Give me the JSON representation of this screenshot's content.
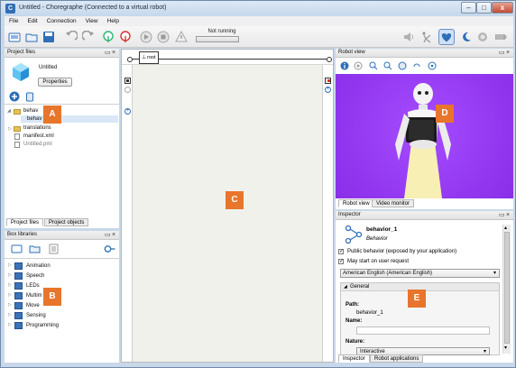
{
  "window": {
    "title": "Untitled - Choregraphe (Connected to a virtual robot)",
    "app_icon": "C",
    "minimize_glyph": "–",
    "maximize_glyph": "□",
    "close_glyph": "x"
  },
  "menu": [
    "File",
    "Edit",
    "Connection",
    "View",
    "Help"
  ],
  "toolbar": {
    "status_text": "Not running"
  },
  "project_files": {
    "title": "Project files",
    "project_name": "Untitled",
    "properties_button": "Properties",
    "tree": [
      "behav",
      "behav",
      "translations",
      "manifest.xml",
      "Untitled.pml"
    ],
    "tabs": [
      "Project files",
      "Project objects"
    ]
  },
  "box_libraries": {
    "title": "Box libraries",
    "items": [
      "Animation",
      "Speech",
      "LEDs",
      "Multim",
      "Move",
      "Sensing",
      "Programming"
    ]
  },
  "flow": {
    "root_label": "root"
  },
  "robot_view": {
    "title": "Robot view",
    "tabs": [
      "Robot view",
      "Video monitor"
    ]
  },
  "inspector": {
    "title": "Inspector",
    "behavior_name": "behavior_1",
    "behavior_type": "Behavior",
    "public_behavior": "Public behavior (exposed by your application)",
    "may_start": "May start on user request",
    "language": "American English (American English)",
    "section_general": "General",
    "path_label": "Path:",
    "path_value": "behavior_1",
    "name_label": "Name:",
    "nature_label": "Nature:",
    "nature_value": "Interactive",
    "tabs": [
      "Inspector",
      "Robot applications"
    ]
  },
  "markers": [
    "A",
    "B",
    "C",
    "D",
    "E"
  ],
  "colors": {
    "marker": "#e8752c",
    "robot_view_bg": "#9b3cf0",
    "accent": "#2f6fb6"
  }
}
